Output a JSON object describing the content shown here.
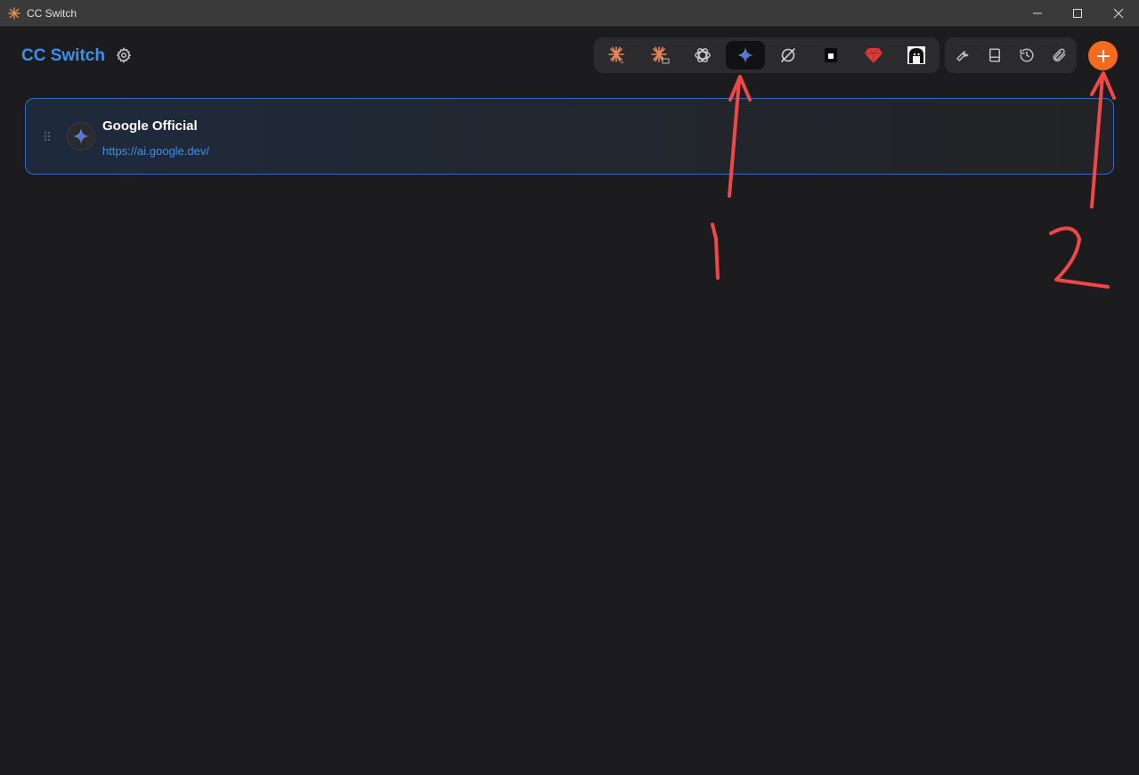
{
  "window": {
    "title": "CC Switch",
    "controls": [
      "minimize-icon",
      "maximize-icon",
      "close-icon"
    ]
  },
  "header": {
    "brand": "CC Switch",
    "settings_icon": "gear-icon"
  },
  "app_switcher": {
    "items": [
      {
        "name": "claude-code-icon",
        "active": false
      },
      {
        "name": "claude-desktop-icon",
        "active": false
      },
      {
        "name": "openai-icon",
        "active": false
      },
      {
        "name": "gemini-icon",
        "active": true
      },
      {
        "name": "opencode-icon",
        "active": false
      },
      {
        "name": "square-icon",
        "active": false
      },
      {
        "name": "ruby-icon",
        "active": false
      },
      {
        "name": "avatar-icon",
        "active": false
      }
    ]
  },
  "tools": {
    "items": [
      "wrench-icon",
      "book-icon",
      "history-icon",
      "paperclip-icon"
    ]
  },
  "add_button": {
    "icon": "plus-icon"
  },
  "provider_card": {
    "name": "Google Official",
    "url": "https://ai.google.dev/",
    "icon": "gemini-icon"
  },
  "annotations": {
    "label_1": "1",
    "label_2": "2"
  },
  "colors": {
    "accent_blue": "#3b8ff0",
    "add_orange": "#f46a1e",
    "annotation_red": "#f04848"
  }
}
